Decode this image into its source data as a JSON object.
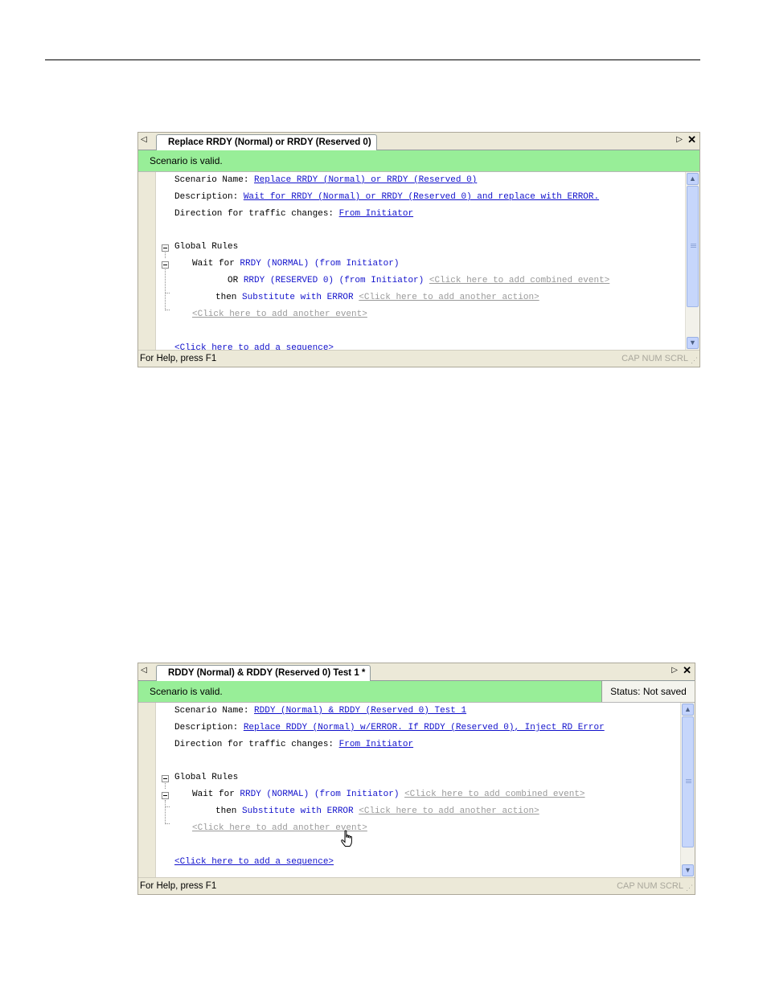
{
  "window1": {
    "tab_title": "Replace RRDY (Normal) or RRDY (Reserved 0)",
    "status": "Scenario is valid.",
    "lines": {
      "name_label": "Scenario Name:",
      "name_value": "Replace RRDY (Normal) or RRDY (Reserved 0)",
      "desc_label": "Description:",
      "desc_value": "Wait for RRDY (Normal) or RRDY (Reserved 0) and replace with ERROR.",
      "dir_label": "Direction for traffic changes:",
      "dir_value": "From Initiator",
      "global_rules": "Global Rules",
      "wait_for": "Wait for",
      "event1": "RRDY (NORMAL) (from Initiator)",
      "or_label": "OR",
      "event2": "RRDY (RESERVED 0) (from Initiator)",
      "add_combined": "<Click here to add combined event>",
      "then_label": "then",
      "action": "Substitute with ERROR",
      "add_action": "<Click here to add another action>",
      "add_event": "<Click here to add another event>",
      "add_sequence": "<Click here to add a sequence>"
    },
    "footer_help": "For Help, press F1",
    "footer_keys": "CAP  NUM  SCRL"
  },
  "window2": {
    "tab_title": "RDDY (Normal) & RDDY (Reserved 0) Test 1 *",
    "status": "Scenario is valid.",
    "status_badge": "Status: Not saved",
    "lines": {
      "name_label": "Scenario Name:",
      "name_value": "RDDY (Normal) & RDDY (Reserved 0) Test 1",
      "desc_label": "Description:",
      "desc_value": "Replace RDDY (Normal) w/ERROR. If RDDY (Reserved 0), Inject RD Error",
      "dir_label": "Direction for traffic changes:",
      "dir_value": "From Initiator",
      "global_rules": "Global Rules",
      "wait_for": "Wait for",
      "event1": "RRDY (NORMAL) (from Initiator)",
      "add_combined": "<Click here to add combined event>",
      "then_label": "then",
      "action": "Substitute with ERROR",
      "add_action": "<Click here to add another action>",
      "add_event": "<Click here to add another event>",
      "add_sequence": "<Click here to add a sequence>"
    },
    "footer_help": "For Help, press F1",
    "footer_keys": "CAP  NUM  SCRL"
  },
  "icons": {
    "nav_left": "triangle-left-icon",
    "nav_right": "triangle-right-icon",
    "close": "close-icon",
    "scroll_up": "chevron-up-icon",
    "scroll_down": "chevron-down-icon",
    "tree_collapse": "minus-box-icon",
    "cursor": "hand-pointer-icon"
  }
}
